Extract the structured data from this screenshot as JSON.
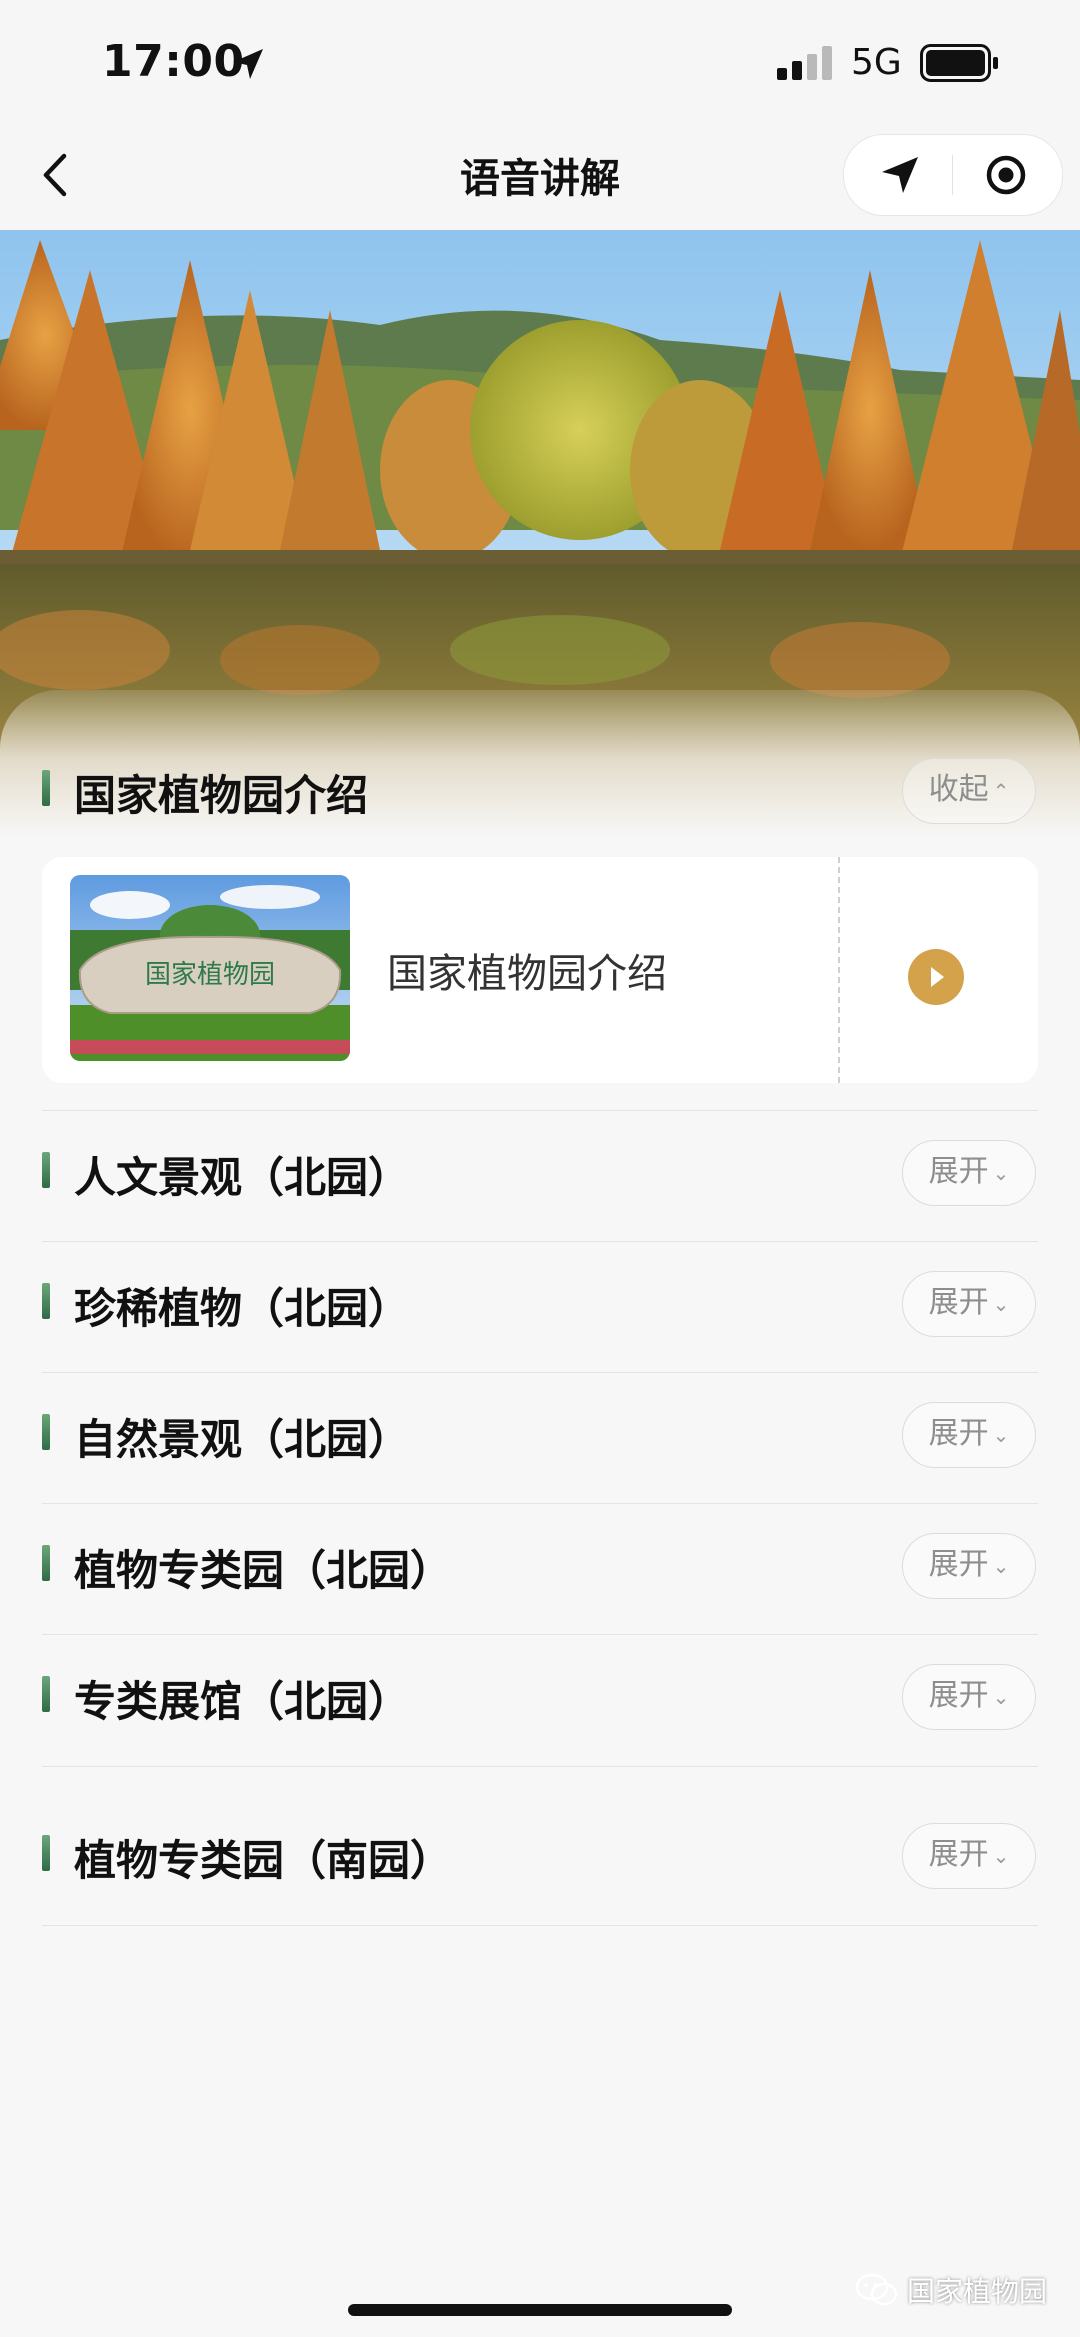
{
  "status_bar": {
    "time": "17:00",
    "network": "5G"
  },
  "nav": {
    "title": "语音讲解",
    "icons": [
      "back-icon",
      "navigation-arrow-icon",
      "target-icon"
    ]
  },
  "expanded_section": {
    "title": "国家植物园介绍",
    "toggle_label": "收起",
    "toggle_chevron": "⌃",
    "item": {
      "title": "国家植物园介绍",
      "stone_inscription": "国家植物园"
    }
  },
  "sections": [
    {
      "title": "人文景观（北园）",
      "toggle_label": "展开"
    },
    {
      "title": "珍稀植物（北园）",
      "toggle_label": "展开"
    },
    {
      "title": "自然景观（北园）",
      "toggle_label": "展开"
    },
    {
      "title": "植物专类园（北园）",
      "toggle_label": "展开"
    },
    {
      "title": "专类展馆（北园）",
      "toggle_label": "展开"
    },
    {
      "title": "植物专类园（南园）",
      "toggle_label": "展开"
    }
  ],
  "toggle_chevron_down": "⌄",
  "watermark": "国家植物园",
  "colors": {
    "accent_green": "#3f7f55",
    "play_gold": "#d4a24a",
    "toggle_text": "#8e8e8e"
  }
}
